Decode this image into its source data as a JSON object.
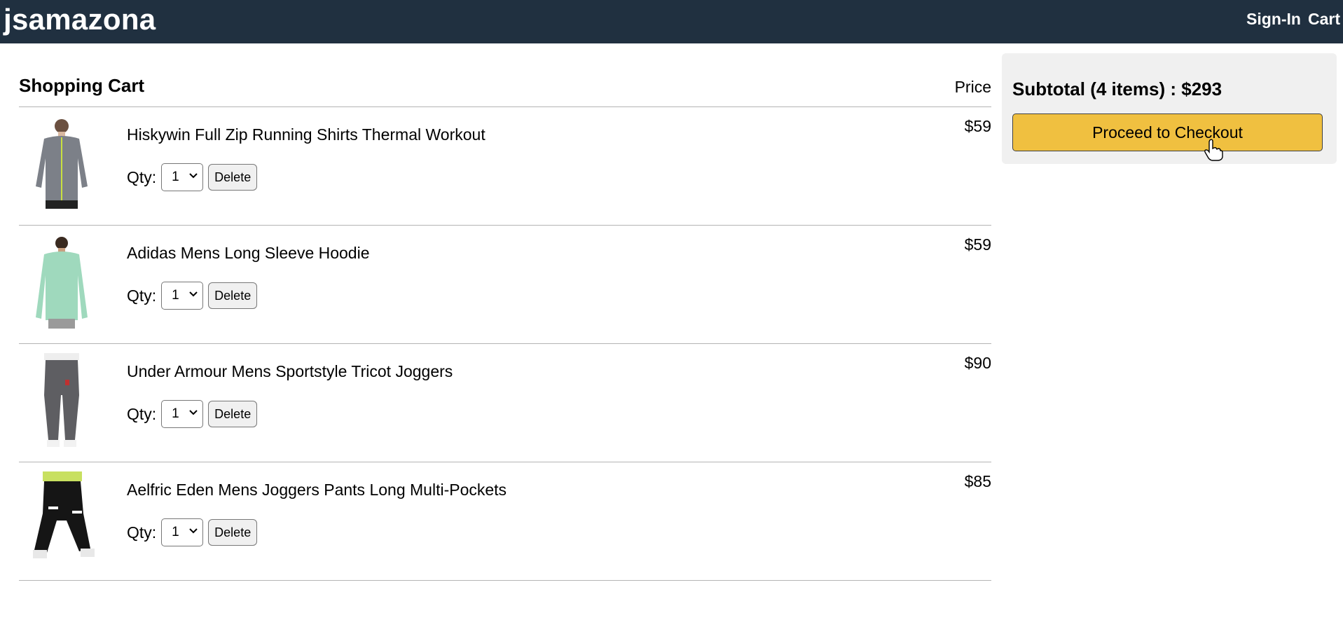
{
  "header": {
    "brand": "jsamazona",
    "links": [
      "Sign-In",
      "Cart"
    ]
  },
  "cart": {
    "title": "Shopping Cart",
    "price_header": "Price",
    "qty_label": "Qty:",
    "delete_label": "Delete",
    "items": [
      {
        "name": "Hiskywin Full Zip Running Shirts Thermal Workout",
        "qty": "1",
        "price": "$59"
      },
      {
        "name": "Adidas Mens Long Sleeve Hoodie",
        "qty": "1",
        "price": "$59"
      },
      {
        "name": "Under Armour Mens Sportstyle Tricot Joggers",
        "qty": "1",
        "price": "$90"
      },
      {
        "name": "Aelfric Eden Mens Joggers Pants Long Multi-Pockets",
        "qty": "1",
        "price": "$85"
      }
    ]
  },
  "summary": {
    "subtotal": "Subtotal (4 items) : $293",
    "checkout_label": "Proceed to Checkout"
  },
  "colors": {
    "header_bg": "#203040",
    "checkout_bg": "#f0c040",
    "summary_bg": "#f0f0f0"
  },
  "icons": [
    "chevron-down-icon",
    "hand-pointer-cursor-icon"
  ]
}
